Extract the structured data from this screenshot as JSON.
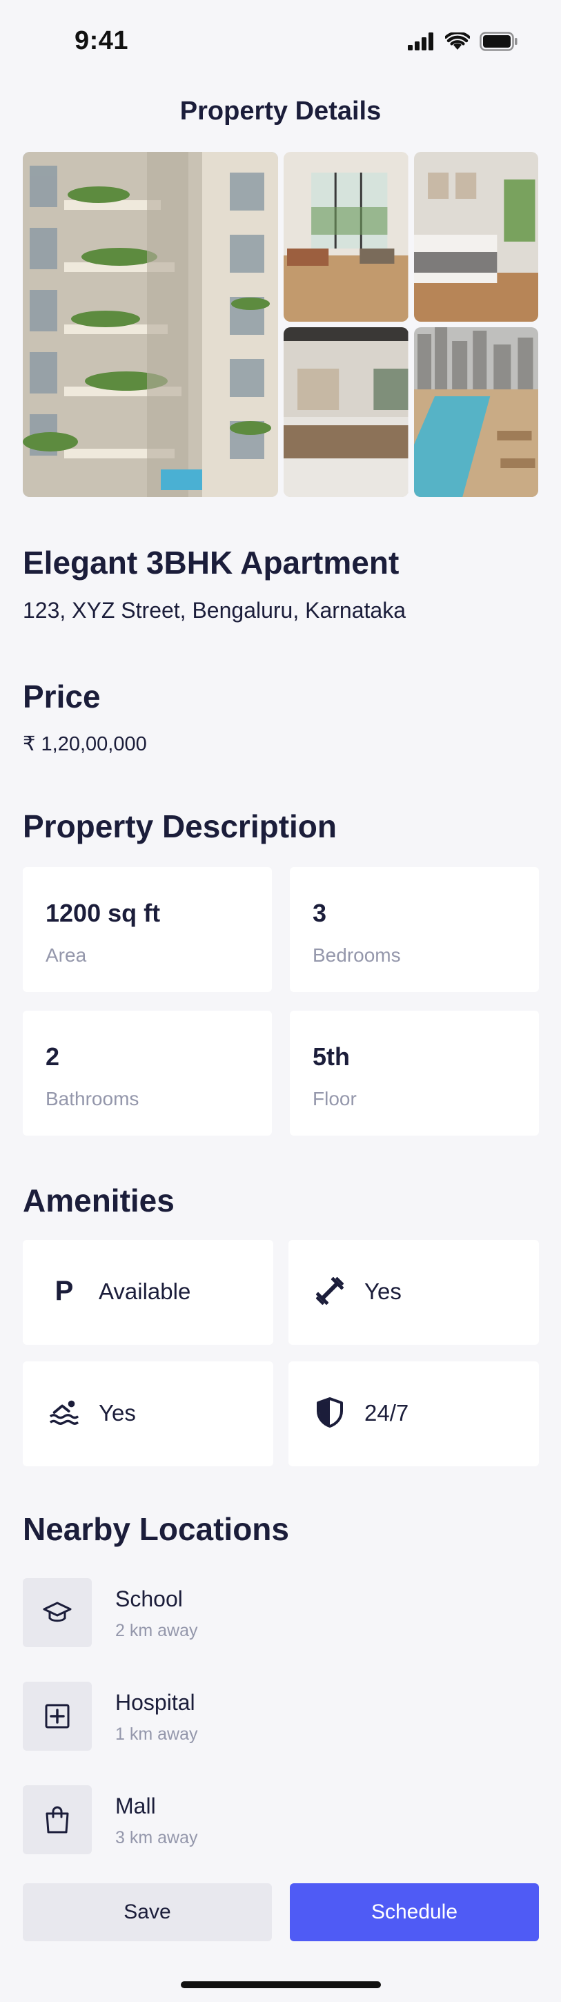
{
  "status_bar": {
    "time": "9:41"
  },
  "header": {
    "title": "Property Details"
  },
  "property": {
    "title": "Elegant 3BHK Apartment",
    "address": "123, XYZ Street, Bengaluru, Karnataka"
  },
  "price": {
    "heading": "Price",
    "value": "₹ 1,20,00,000"
  },
  "description": {
    "heading": "Property Description",
    "stats": [
      {
        "value": "1200 sq ft",
        "label": "Area"
      },
      {
        "value": "3",
        "label": "Bedrooms"
      },
      {
        "value": "2",
        "label": "Bathrooms"
      },
      {
        "value": "5th",
        "label": "Floor"
      }
    ]
  },
  "amenities": {
    "heading": "Amenities",
    "items": [
      {
        "icon": "parking-icon",
        "glyph": "P",
        "text": "Available"
      },
      {
        "icon": "dumbbell-icon",
        "text": "Yes"
      },
      {
        "icon": "pool-icon",
        "text": "Yes"
      },
      {
        "icon": "shield-icon",
        "text": "24/7"
      }
    ]
  },
  "nearby": {
    "heading": "Nearby Locations",
    "items": [
      {
        "icon": "school-cap-icon",
        "name": "School",
        "distance": "2 km away"
      },
      {
        "icon": "hospital-plus-icon",
        "name": "Hospital",
        "distance": "1 km away"
      },
      {
        "icon": "shopping-bag-icon",
        "name": "Mall",
        "distance": "3 km away"
      }
    ]
  },
  "actions": {
    "save_label": "Save",
    "schedule_label": "Schedule"
  },
  "colors": {
    "primary": "#4f5bf5",
    "text": "#1b1d3a",
    "muted": "#9497ab",
    "background": "#f6f6f9"
  }
}
